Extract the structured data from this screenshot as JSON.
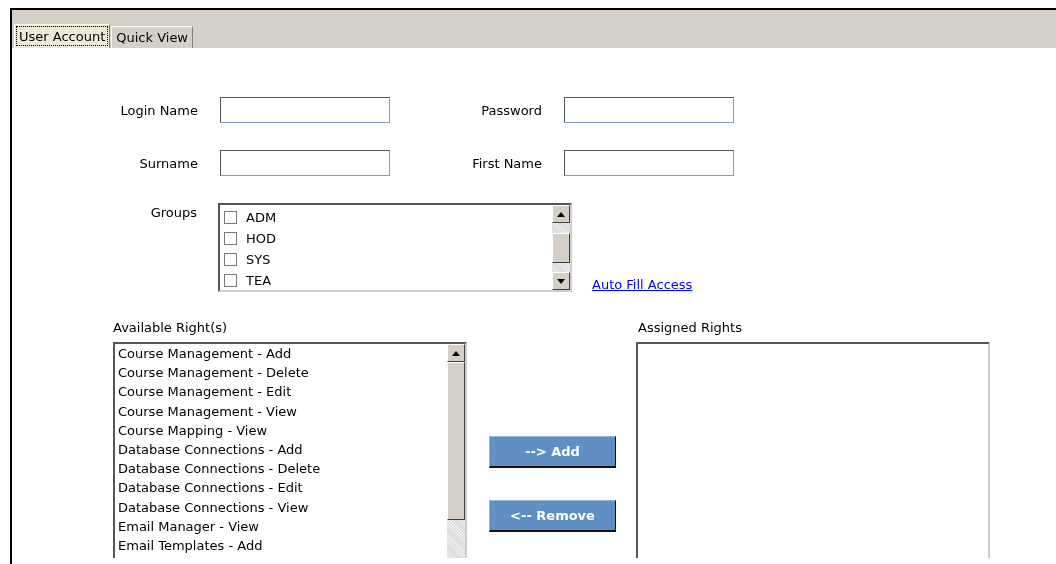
{
  "tabs": [
    {
      "label": "User Account",
      "selected": true
    },
    {
      "label": "Quick View",
      "selected": false
    }
  ],
  "fields": [
    {
      "label": "Login Name"
    },
    {
      "label": "Password"
    },
    {
      "label": "Surname"
    },
    {
      "label": "First Name"
    }
  ],
  "groups": {
    "label": "Groups",
    "items": [
      {
        "label": "ADM",
        "checked": false
      },
      {
        "label": "HOD",
        "checked": false
      },
      {
        "label": "SYS",
        "checked": false
      },
      {
        "label": "TEA",
        "checked": false
      }
    ]
  },
  "auto_fill_link": "Auto Fill Access",
  "available_rights": {
    "label": "Available Right(s)",
    "items": [
      "Course Management - Add",
      "Course Management - Delete",
      "Course Management - Edit",
      "Course Management - View",
      "Course Mapping - View",
      "Database Connections - Add",
      "Database Connections - Delete",
      "Database Connections - Edit",
      "Database Connections - View",
      "Email Manager - View",
      "Email Templates - Add"
    ]
  },
  "buttons": [
    {
      "label": "--> Add"
    },
    {
      "label": "<-- Remove"
    }
  ],
  "assigned_rights": {
    "label": "Assigned Rights"
  }
}
